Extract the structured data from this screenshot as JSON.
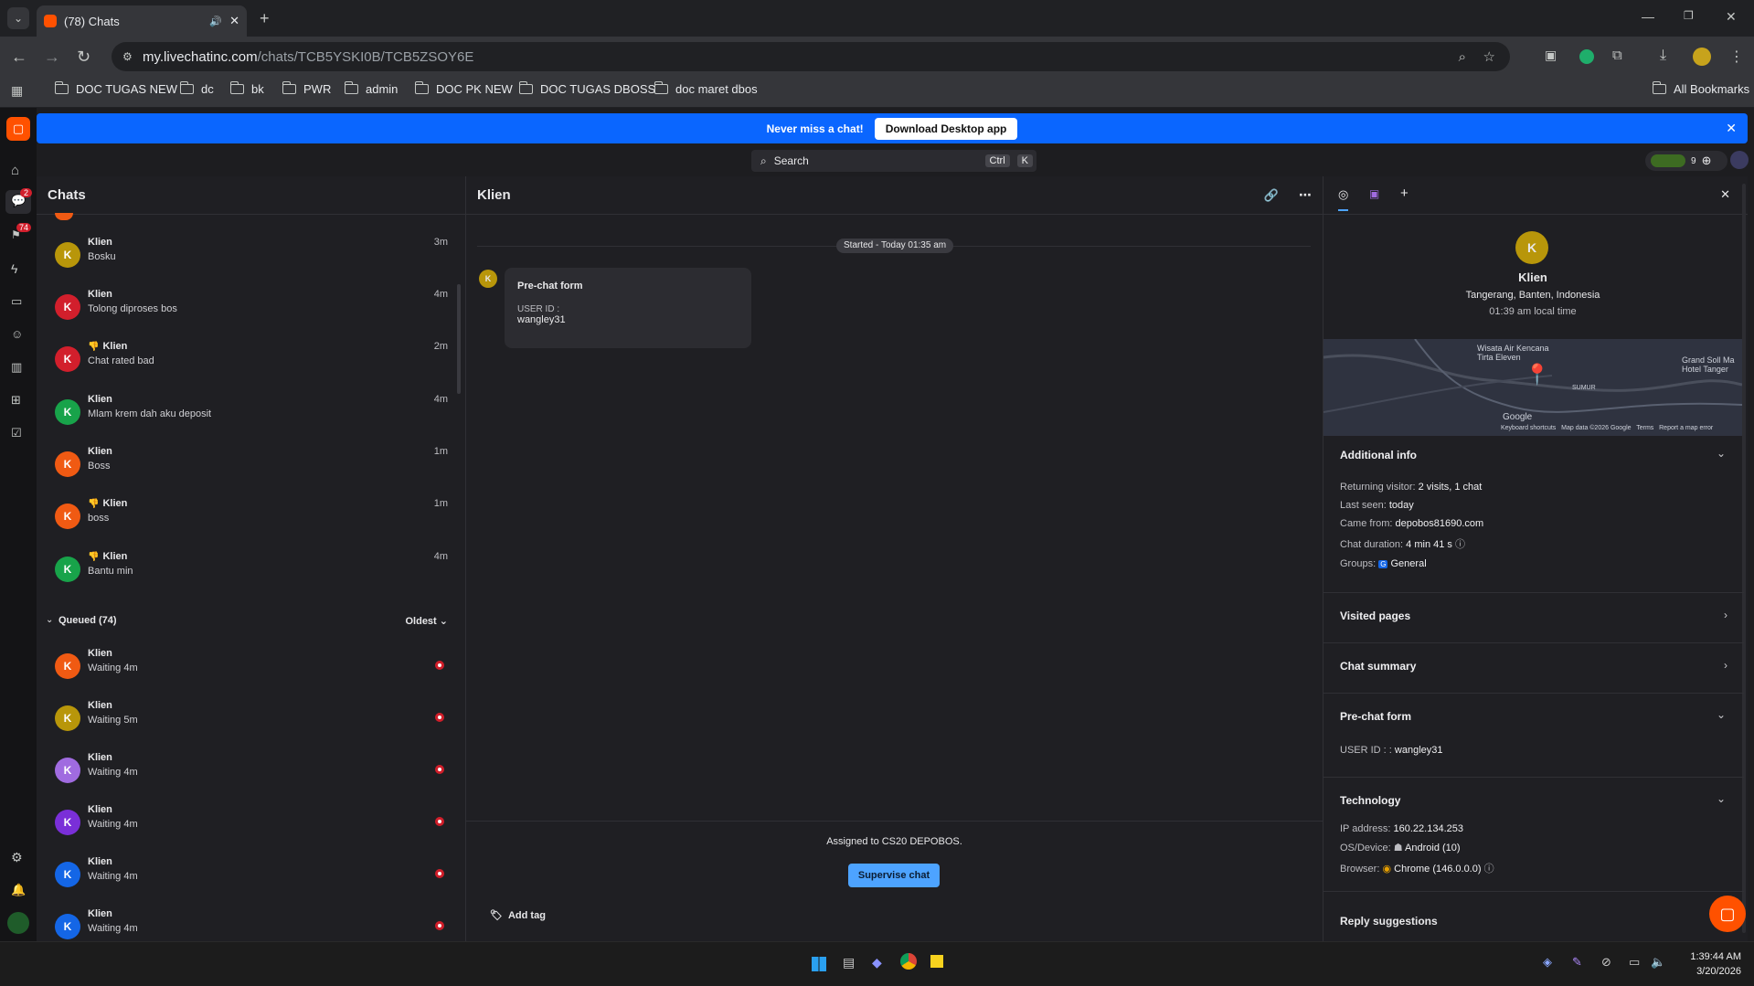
{
  "browser": {
    "tab_title": "(78) Chats",
    "url_host": "my.livechatinc.com",
    "url_path": "/chats/TCB5YSKI0B/TCB5ZSOY6E",
    "bookmarks": [
      "DOC TUGAS NEW",
      "dc",
      "bk",
      "PWR",
      "admin",
      "DOC PK NEW",
      "DOC TUGAS DBOSS",
      "doc maret dbos"
    ],
    "all_bookmarks": "All Bookmarks"
  },
  "banner": {
    "text": "Never miss a chat!",
    "button": "Download Desktop app"
  },
  "search": {
    "label": "Search",
    "kbd1": "Ctrl",
    "kbd2": "K"
  },
  "nav": {
    "chats_badge": "2",
    "traffic_badge": "74"
  },
  "top_right": {
    "counter": "9"
  },
  "chats_panel": {
    "title": "Chats",
    "active": [
      {
        "name": "Klien",
        "msg": "Bosku",
        "time": "3m",
        "color": "#b8960a",
        "rated_bad": false
      },
      {
        "name": "Klien",
        "msg": "Tolong diproses bos",
        "time": "4m",
        "color": "#d21f2c",
        "rated_bad": false
      },
      {
        "name": "Klien",
        "msg": "Chat rated bad",
        "time": "2m",
        "color": "#d21f2c",
        "rated_bad": true
      },
      {
        "name": "Klien",
        "msg": "Mlam krem dah aku deposit",
        "time": "4m",
        "color": "#18a34a",
        "rated_bad": false
      },
      {
        "name": "Klien",
        "msg": "Boss",
        "time": "1m",
        "color": "#f05a13",
        "rated_bad": false
      },
      {
        "name": "Klien",
        "msg": "boss",
        "time": "1m",
        "color": "#f05a13",
        "rated_bad": true
      },
      {
        "name": "Klien",
        "msg": "Bantu min",
        "time": "4m",
        "color": "#18a34a",
        "rated_bad": true
      }
    ],
    "queued_label": "Queued (74)",
    "sort_label": "Oldest",
    "queued": [
      {
        "name": "Klien",
        "msg": "Waiting 4m",
        "color": "#f05a13"
      },
      {
        "name": "Klien",
        "msg": "Waiting 5m",
        "color": "#b8960a"
      },
      {
        "name": "Klien",
        "msg": "Waiting 4m",
        "color": "#a06be0"
      },
      {
        "name": "Klien",
        "msg": "Waiting 4m",
        "color": "#7a2fd8"
      },
      {
        "name": "Klien",
        "msg": "Waiting 4m",
        "color": "#1466e6"
      },
      {
        "name": "Klien",
        "msg": "Waiting 4m",
        "color": "#1466e6"
      }
    ]
  },
  "conversation": {
    "title": "Klien",
    "started": "Started - Today 01:35 am",
    "card_title": "Pre-chat form",
    "card_label": "USER ID :",
    "card_value": "wangley31",
    "assigned": "Assigned to CS20 DEPOBOS.",
    "supervise": "Supervise chat",
    "add_tag": "Add tag",
    "avatar_letter": "K"
  },
  "details": {
    "avatar_letter": "K",
    "name": "Klien",
    "location": "Tangerang, Banten, Indonesia",
    "local_time": "01:39 am local time",
    "map_labels": {
      "place": "Wisata Air Kencana Tirta Eleven",
      "hotel": "Grand Soll Ma Hotel Tanger",
      "area": "SUMUR",
      "google": "Google",
      "footer": "Keyboard shortcuts   Map data ©2026 Google   Terms   Report a map error"
    },
    "additional_info": {
      "title": "Additional info",
      "returning_label": "Returning visitor:",
      "returning_value": "2 visits, 1 chat",
      "lastseen_label": "Last seen:",
      "lastseen_value": "today",
      "came_label": "Came from:",
      "came_value": "depobos81690.com",
      "duration_label": "Chat duration:",
      "duration_value": "4 min 41 s",
      "groups_label": "Groups:",
      "groups_badge": "G",
      "groups_value": "General"
    },
    "visited_pages": "Visited pages",
    "chat_summary": "Chat summary",
    "prechat": {
      "title": "Pre-chat form",
      "label": "USER ID : :",
      "value": "wangley31"
    },
    "technology": {
      "title": "Technology",
      "ip_label": "IP address:",
      "ip_value": "160.22.134.253",
      "os_label": "OS/Device:",
      "os_value": "Android (10)",
      "browser_label": "Browser:",
      "browser_value": "Chrome (146.0.0.0)"
    },
    "reply_suggestions": "Reply suggestions"
  },
  "taskbar": {
    "time": "1:39:44 AM",
    "date": "3/20/2026"
  }
}
